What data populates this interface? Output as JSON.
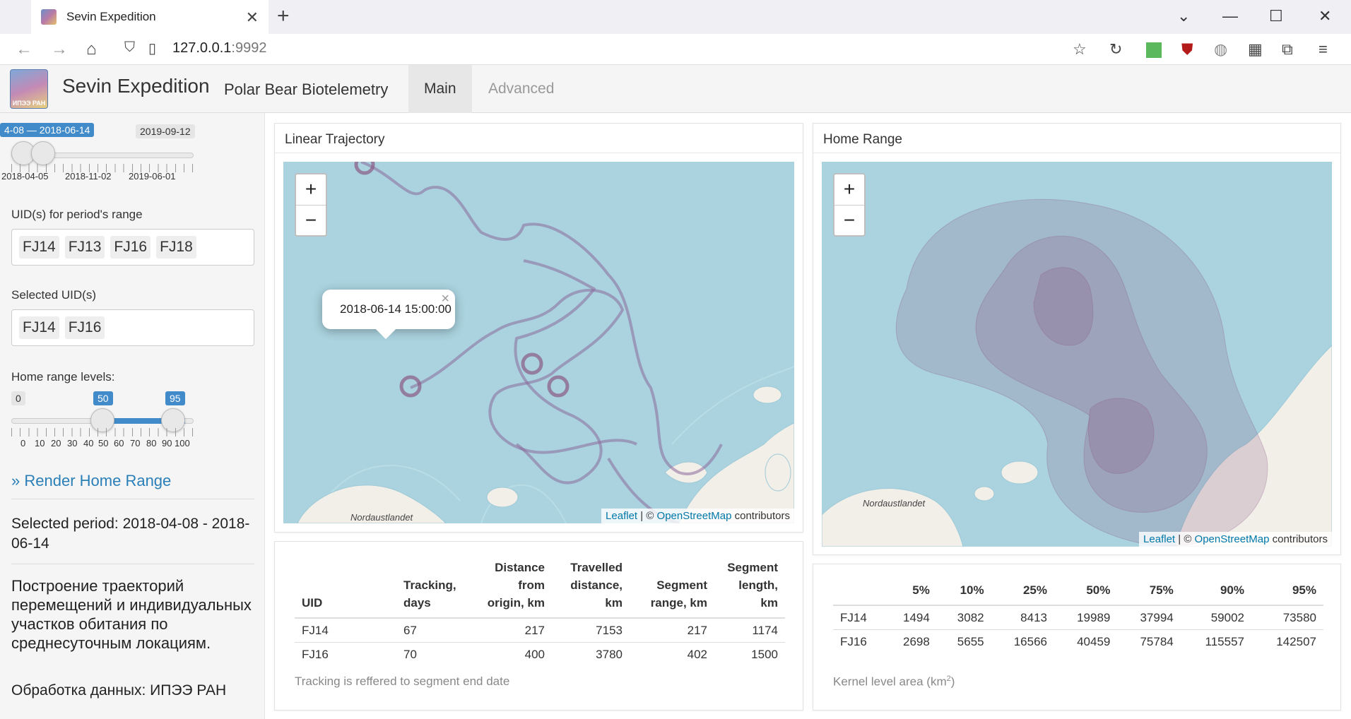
{
  "browser": {
    "tab_title": "Sevin Expedition",
    "url_host": "127.0.0.1",
    "url_port": ":9992"
  },
  "navbar": {
    "brand": "Sevin Expedition",
    "subtitle": "Polar Bear Biotelemetry",
    "logo_text": "ИПЭЭ РАН",
    "tabs": [
      {
        "label": "Main",
        "active": true
      },
      {
        "label": "Advanced",
        "active": false
      }
    ]
  },
  "sidebar": {
    "date_slider": {
      "range_badge": "4-08 — 2018-06-14",
      "max_badge": "2019-09-12",
      "tick_labels": [
        "2018-04-05",
        "2018-11-02",
        "2019-06-01"
      ],
      "from_fraction": 0.01,
      "to_fraction": 0.09
    },
    "uid_period_label": "UID(s) for period's range",
    "uid_period_values": [
      "FJ14",
      "FJ13",
      "FJ16",
      "FJ18"
    ],
    "selected_uid_label": "Selected UID(s)",
    "selected_uid_values": [
      "FJ14",
      "FJ16"
    ],
    "home_range_label": "Home range levels:",
    "home_range_slider": {
      "min_badge": "0",
      "from_badge": "50",
      "to_badge": "95",
      "tick_labels": [
        "0",
        "10",
        "20",
        "30",
        "40",
        "50",
        "60",
        "70",
        "80",
        "90",
        "100"
      ]
    },
    "render_button": "Render Home Range",
    "selected_period": "Selected period: 2018-04-08 - 2018-06-14",
    "description": "Построение траекторий перемещений и индивидуальных участков обитания по среднесуточным локациям.",
    "processing": "Обработка данных: ИПЭЭ РАН"
  },
  "trajectory_panel": {
    "title": "Linear Trajectory",
    "popup_text": "2018-06-14 15:00:00",
    "map_label": "Nordaustlandet",
    "attribution": {
      "leaflet": "Leaflet",
      "sep": " | © ",
      "osm": "OpenStreetMap",
      "tail": " contributors"
    },
    "zoom_in": "+",
    "zoom_out": "−"
  },
  "homerange_panel": {
    "title": "Home Range",
    "map_label": "Nordaustlandet",
    "attribution": {
      "leaflet": "Leaflet",
      "sep": " | © ",
      "osm": "OpenStreetMap",
      "tail": " contributors"
    },
    "zoom_in": "+",
    "zoom_out": "−"
  },
  "tracking_table": {
    "headers": [
      "UID",
      "Tracking, days",
      "Distance from origin, km",
      "Travelled distance, km",
      "Segment range, km",
      "Segment length, km"
    ],
    "rows": [
      [
        "FJ14",
        "67",
        "217",
        "7153",
        "217",
        "1174"
      ],
      [
        "FJ16",
        "70",
        "400",
        "3780",
        "402",
        "1500"
      ]
    ],
    "caption": "Tracking is reffered to segment end date"
  },
  "kernel_table": {
    "headers": [
      "",
      "5%",
      "10%",
      "25%",
      "50%",
      "75%",
      "90%",
      "95%"
    ],
    "rows": [
      [
        "FJ14",
        "1494",
        "3082",
        "8413",
        "19989",
        "37994",
        "59002",
        "73580"
      ],
      [
        "FJ16",
        "2698",
        "5655",
        "16566",
        "40459",
        "75784",
        "115557",
        "142507"
      ]
    ],
    "caption_prefix": "Kernel level area (km",
    "caption_sup": "2",
    "caption_suffix": ")"
  }
}
